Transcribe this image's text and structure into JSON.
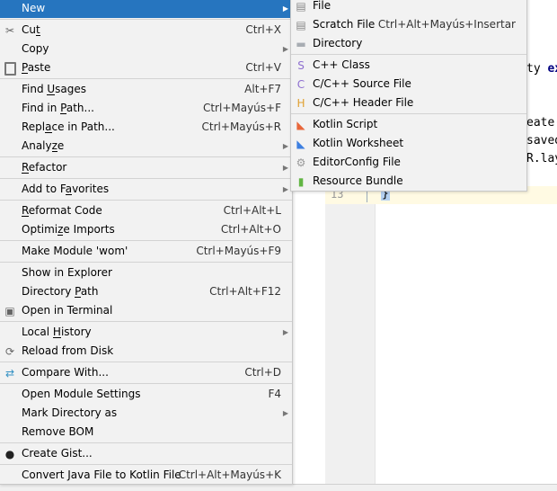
{
  "editor": {
    "line_number": "13",
    "closing_brace": "}",
    "fragments": [
      {
        "text": "ty ",
        "kw": "ex"
      },
      {
        "text": "eate(",
        "kw": ""
      },
      {
        "text": "saved",
        "kw": ""
      },
      {
        "text": "R.lay",
        "kw": ""
      }
    ]
  },
  "context_menu": [
    {
      "label": "New",
      "submenu": true,
      "highlighted": true
    },
    {
      "sep": true
    },
    {
      "label": "Cut",
      "mn": 2,
      "shortcut": "Ctrl+X",
      "icon": "scissors-icon",
      "glyph": "✂"
    },
    {
      "label": "Copy",
      "submenu": true
    },
    {
      "label": "Paste",
      "mn": 0,
      "shortcut": "Ctrl+V",
      "icon": "clipboard-icon",
      "glyph": "📋"
    },
    {
      "sep": true
    },
    {
      "label": "Find Usages",
      "mn": 5,
      "shortcut": "Alt+F7"
    },
    {
      "label": "Find in Path...",
      "mn": 8,
      "shortcut": "Ctrl+Mayús+F"
    },
    {
      "label": "Replace in Path...",
      "mn": 4,
      "shortcut": "Ctrl+Mayús+R"
    },
    {
      "label": "Analyze",
      "mn": 5,
      "submenu": true
    },
    {
      "sep": true
    },
    {
      "label": "Refactor",
      "mn": 0,
      "submenu": true
    },
    {
      "sep": true
    },
    {
      "label": "Add to Favorites",
      "mn": 8,
      "submenu": true
    },
    {
      "sep": true
    },
    {
      "label": "Reformat Code",
      "mn": 0,
      "shortcut": "Ctrl+Alt+L"
    },
    {
      "label": "Optimize Imports",
      "mn": 6,
      "shortcut": "Ctrl+Alt+O"
    },
    {
      "sep": true
    },
    {
      "label": "Make Module 'wom'",
      "shortcut": "Ctrl+Mayús+F9"
    },
    {
      "sep": true
    },
    {
      "label": "Show in Explorer"
    },
    {
      "label": "Directory Path",
      "mn": 10,
      "shortcut": "Ctrl+Alt+F12"
    },
    {
      "label": "Open in Terminal",
      "icon": "terminal-icon",
      "glyph": "▣"
    },
    {
      "sep": true
    },
    {
      "label": "Local History",
      "mn": 6,
      "submenu": true
    },
    {
      "label": "Reload from Disk",
      "icon": "reload-icon",
      "glyph": "⟳"
    },
    {
      "sep": true
    },
    {
      "label": "Compare With...",
      "shortcut": "Ctrl+D",
      "icon": "compare-icon",
      "glyph": "⇄",
      "color": "#3592c4"
    },
    {
      "sep": true
    },
    {
      "label": "Open Module Settings",
      "shortcut": "F4"
    },
    {
      "label": "Mark Directory as",
      "submenu": true
    },
    {
      "label": "Remove BOM"
    },
    {
      "sep": true
    },
    {
      "label": "Create Gist...",
      "icon": "github-icon",
      "glyph": "●",
      "color": "#222"
    },
    {
      "sep": true
    },
    {
      "label": "Convert Java File to Kotlin File",
      "shortcut": "Ctrl+Alt+Mayús+K"
    }
  ],
  "new_submenu": [
    {
      "label": "File",
      "icon": "file-icon",
      "glyph": "▤",
      "color": "#888"
    },
    {
      "label": "Scratch File",
      "shortcut": "Ctrl+Alt+Mayús+Insertar",
      "icon": "scratch-file-icon",
      "glyph": "▤",
      "color": "#888"
    },
    {
      "label": "Directory",
      "icon": "folder-icon",
      "glyph": "▬",
      "color": "#a8adb3"
    },
    {
      "sep": true
    },
    {
      "label": "C++ Class",
      "icon": "cpp-class-icon",
      "glyph": "S",
      "color": "#8e6fd0"
    },
    {
      "label": "C/C++ Source File",
      "icon": "cpp-source-icon",
      "glyph": "C",
      "color": "#8e6fd0"
    },
    {
      "label": "C/C++ Header File",
      "icon": "cpp-header-icon",
      "glyph": "H",
      "color": "#e0a030"
    },
    {
      "sep": true
    },
    {
      "label": "Kotlin Script",
      "icon": "kotlin-script-icon",
      "glyph": "◣",
      "color": "#e8663a"
    },
    {
      "label": "Kotlin Worksheet",
      "icon": "kotlin-worksheet-icon",
      "glyph": "◣",
      "color": "#3d7fe0"
    },
    {
      "label": "EditorConfig File",
      "icon": "gear-icon",
      "glyph": "⚙",
      "color": "#999"
    },
    {
      "label": "Resource Bundle",
      "icon": "resource-bundle-icon",
      "glyph": "▮",
      "color": "#62b543"
    }
  ]
}
